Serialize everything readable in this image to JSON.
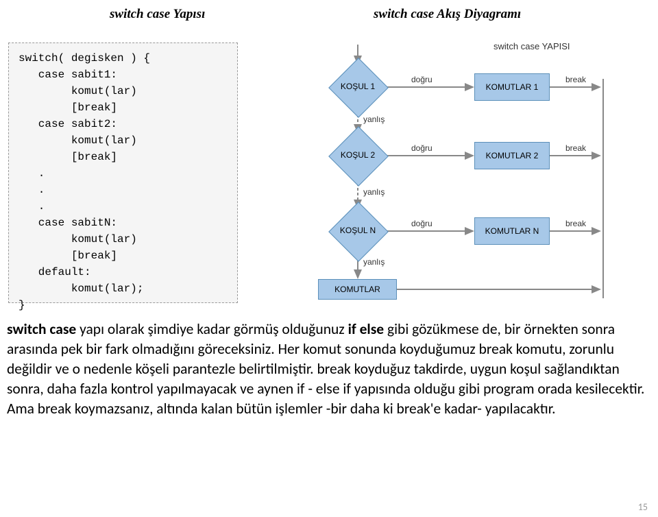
{
  "headings": {
    "left": "switch case Yapısı",
    "right": "switch case Akış Diyagramı"
  },
  "code": "switch( degisken ) {\n   case sabit1:\n        komut(lar)\n        [break]\n   case sabit2:\n        komut(lar)\n        [break]\n   .\n   .\n   .\n   case sabitN:\n        komut(lar)\n        [break]\n   default:\n        komut(lar);\n}",
  "diagram": {
    "title": "switch case YAPISI",
    "conditions": [
      "KOŞUL 1",
      "KOŞUL 2",
      "KOŞUL N"
    ],
    "commands": [
      "KOMUTLAR 1",
      "KOMUTLAR 2",
      "KOMUTLAR N"
    ],
    "default": "KOMUTLAR",
    "true_label": "doğru",
    "false_label": "yanlış",
    "break_label": "break"
  },
  "paragraph": {
    "p1a": "switch case",
    "p1b": " yapı olarak şimdiye kadar görmüş olduğunuz ",
    "p1c": "if else",
    "p1d": " gibi gözükmese de, bir örnekten sonra arasında pek bir fark olmadığını göreceksiniz. Her komut sonunda koyduğumuz break komutu, zorunlu değildir ve o nedenle köşeli parantezle belirtilmiştir. break koyduğuz takdirde, uygun koşul sağlandıktan sonra, daha fazla kontrol yapılmayacak ve aynen if - else if yapısında olduğu gibi program orada kesilecektir. Ama break koymazsanız, altında kalan bütün işlemler -bir daha ki break'e kadar- yapılacaktır."
  },
  "pagenum": "15"
}
